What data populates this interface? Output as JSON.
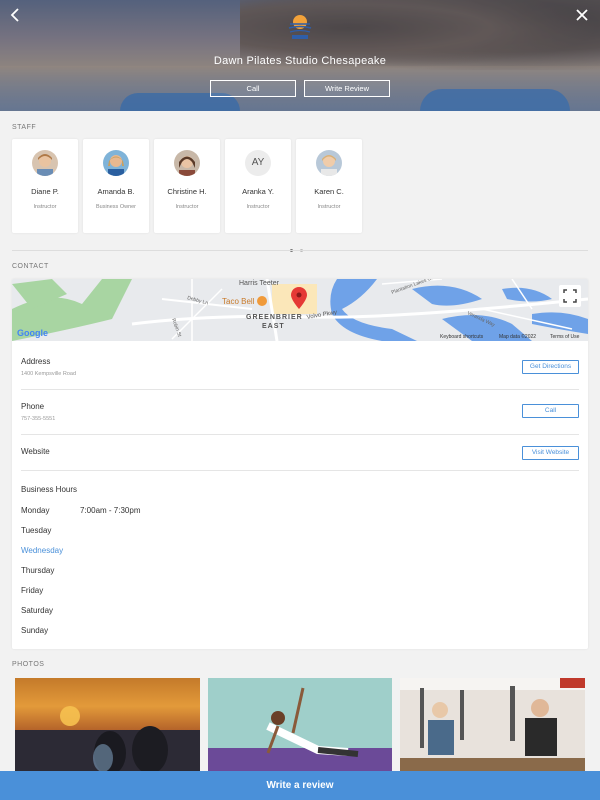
{
  "header": {
    "studio_name": "Dawn Pilates Studio Chesapeake",
    "call_label": "Call",
    "write_review_label": "Write Review"
  },
  "staff": {
    "section_label": "STAFF",
    "members": [
      {
        "name": "Diane P.",
        "role": "Instructor",
        "initials": ""
      },
      {
        "name": "Amanda B.",
        "role": "Business Owner",
        "initials": ""
      },
      {
        "name": "Christine H.",
        "role": "Instructor",
        "initials": ""
      },
      {
        "name": "Aranka Y.",
        "role": "Instructor",
        "initials": "AY"
      },
      {
        "name": "Karen C.",
        "role": "Instructor",
        "initials": ""
      }
    ]
  },
  "contact": {
    "section_label": "CONTACT",
    "map": {
      "labels": {
        "harris_teeter": "Harris Teeter",
        "taco_bell": "Taco Bell",
        "greenbrier": "GREENBRIER",
        "east": "EAST",
        "volvo_pkwy": "Volvo Pkwy",
        "plantation_lakes": "Plantation Lakes Cir",
        "veranda": "Veranda Way",
        "debby_ln": "Debby Ln",
        "robin_st": "Robin St",
        "google": "Google",
        "keyboard_shortcuts": "Keyboard shortcuts",
        "map_data": "Map data ©2022",
        "terms": "Terms of Use"
      }
    },
    "address_label": "Address",
    "address_value": "1400 Kempsville Road",
    "get_directions_label": "Get Directions",
    "phone_label": "Phone",
    "phone_value": "757-355-5551",
    "call_label": "Call",
    "website_label": "Website",
    "visit_website_label": "Visit Website",
    "business_hours_label": "Business Hours",
    "days": [
      {
        "day": "Monday",
        "hours": "7:00am - 7:30pm"
      },
      {
        "day": "Tuesday",
        "hours": ""
      },
      {
        "day": "Wednesday",
        "hours": ""
      },
      {
        "day": "Thursday",
        "hours": ""
      },
      {
        "day": "Friday",
        "hours": ""
      },
      {
        "day": "Saturday",
        "hours": ""
      },
      {
        "day": "Sunday",
        "hours": ""
      }
    ],
    "today": "Wednesday"
  },
  "photos": {
    "section_label": "PHOTOS"
  },
  "footer": {
    "write_review_label": "Write a review"
  },
  "colors": {
    "accent": "#4a90d9",
    "map_water": "#6fa2e8",
    "map_park": "#a8d5a2"
  }
}
